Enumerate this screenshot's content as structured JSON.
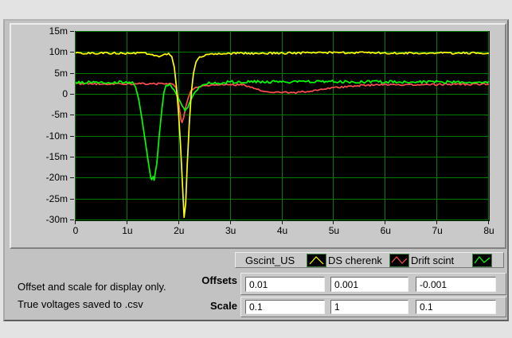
{
  "colors": {
    "page_bg": "#e3e3e3",
    "window_bg": "#c2c2c2",
    "panel_bg": "#c9c9c9",
    "plot_bg": "#000000",
    "grid": "#007c00",
    "glyph_border": "#3f7f3f",
    "field_bg": "#ffffff"
  },
  "legend": {
    "items": [
      {
        "label": "Gscint_US",
        "color": "#ffff00"
      },
      {
        "label": "DS cherenk",
        "color": "#ff5050"
      },
      {
        "label": "Drift scint",
        "color": "#00ff00"
      }
    ]
  },
  "controls": {
    "offsets_label": "Offsets",
    "scale_label": "Scale",
    "offsets": [
      "0.01",
      "0.001",
      "-0.001"
    ],
    "scale": [
      "0.1",
      "1",
      "0.1"
    ]
  },
  "notes": {
    "line1": "Offset and scale for display only.",
    "line2": "True voltages saved to .csv"
  },
  "chart_data": {
    "type": "line",
    "title": "",
    "xlabel": "",
    "ylabel": "",
    "x_min": 0,
    "x_max": 8,
    "x_unit": "us",
    "y_top_mv": 15,
    "y_bottom_mv": -30,
    "grid": true,
    "legend_position": "below-right",
    "xticks": [
      "0",
      "1u",
      "2u",
      "3u",
      "4u",
      "5u",
      "6u",
      "7u",
      "8u"
    ],
    "yticks": [
      "15m",
      "10m",
      "5m",
      "0",
      "-5m",
      "-10m",
      "-15m",
      "-20m",
      "-25m",
      "-30m"
    ],
    "series": [
      {
        "name": "DS cherenk",
        "color": "#ff5050",
        "noise_mv": 0.22,
        "points": [
          [
            0,
            2.6
          ],
          [
            0.8,
            2.6
          ],
          [
            1.6,
            2.6
          ],
          [
            1.88,
            2.5
          ],
          [
            1.94,
            1.8
          ],
          [
            1.98,
            -0.5
          ],
          [
            2.01,
            -3.5
          ],
          [
            2.04,
            -6.0
          ],
          [
            2.06,
            -6.7
          ],
          [
            2.09,
            -5.5
          ],
          [
            2.13,
            -3.0
          ],
          [
            2.18,
            -0.8
          ],
          [
            2.23,
            0.9
          ],
          [
            2.3,
            1.6
          ],
          [
            2.42,
            1.9
          ],
          [
            2.6,
            2.2
          ],
          [
            2.95,
            2.4
          ],
          [
            3.25,
            2.3
          ],
          [
            3.45,
            1.6
          ],
          [
            3.6,
            1.0
          ],
          [
            3.75,
            0.7
          ],
          [
            3.9,
            0.5
          ],
          [
            4.05,
            0.7
          ],
          [
            4.2,
            0.4
          ],
          [
            4.35,
            0.6
          ],
          [
            4.55,
            0.9
          ],
          [
            4.75,
            1.2
          ],
          [
            4.95,
            1.6
          ],
          [
            5.15,
            1.8
          ],
          [
            5.4,
            2.1
          ],
          [
            5.7,
            2.3
          ],
          [
            6.5,
            2.4
          ],
          [
            8,
            2.5
          ]
        ]
      },
      {
        "name": "Drift scint",
        "color": "#00ff00",
        "noise_mv": 0.35,
        "points": [
          [
            0,
            3.0
          ],
          [
            0.6,
            3.0
          ],
          [
            1.1,
            2.9
          ],
          [
            1.16,
            1.8
          ],
          [
            1.22,
            -1.0
          ],
          [
            1.28,
            -5.5
          ],
          [
            1.34,
            -10.5
          ],
          [
            1.4,
            -15.5
          ],
          [
            1.45,
            -19.5
          ],
          [
            1.47,
            -20.3
          ],
          [
            1.5,
            -19.6
          ],
          [
            1.52,
            -20.4
          ],
          [
            1.57,
            -16.5
          ],
          [
            1.62,
            -9.5
          ],
          [
            1.67,
            -3.5
          ],
          [
            1.71,
            0.5
          ],
          [
            1.75,
            2.2
          ],
          [
            1.82,
            2.4
          ],
          [
            1.87,
            1.6
          ],
          [
            1.93,
            0.5
          ],
          [
            2.0,
            -1.2
          ],
          [
            2.06,
            -2.6
          ],
          [
            2.12,
            -3.9
          ],
          [
            2.17,
            -3.0
          ],
          [
            2.24,
            -1.0
          ],
          [
            2.32,
            0.8
          ],
          [
            2.42,
            2.0
          ],
          [
            2.55,
            2.7
          ],
          [
            3.0,
            3.0
          ],
          [
            5.0,
            3.1
          ],
          [
            8,
            3.0
          ]
        ]
      },
      {
        "name": "Gscint_US",
        "color": "#ffff00",
        "noise_mv": 0.25,
        "points": [
          [
            0,
            9.9
          ],
          [
            0.5,
            9.9
          ],
          [
            1.0,
            9.9
          ],
          [
            1.35,
            9.9
          ],
          [
            1.45,
            9.6
          ],
          [
            1.55,
            9.2
          ],
          [
            1.65,
            9.2
          ],
          [
            1.73,
            9.6
          ],
          [
            1.8,
            9.7
          ],
          [
            1.86,
            9.0
          ],
          [
            1.91,
            6.5
          ],
          [
            1.95,
            2.0
          ],
          [
            1.99,
            -4.0
          ],
          [
            2.03,
            -12.0
          ],
          [
            2.07,
            -22.0
          ],
          [
            2.1,
            -29.3
          ],
          [
            2.13,
            -26.0
          ],
          [
            2.16,
            -17.0
          ],
          [
            2.2,
            -7.0
          ],
          [
            2.24,
            0.5
          ],
          [
            2.28,
            5.0
          ],
          [
            2.33,
            7.8
          ],
          [
            2.4,
            9.0
          ],
          [
            2.55,
            9.5
          ],
          [
            2.8,
            9.8
          ],
          [
            3.5,
            9.9
          ],
          [
            5.0,
            10.0
          ],
          [
            8,
            9.9
          ]
        ]
      }
    ]
  }
}
